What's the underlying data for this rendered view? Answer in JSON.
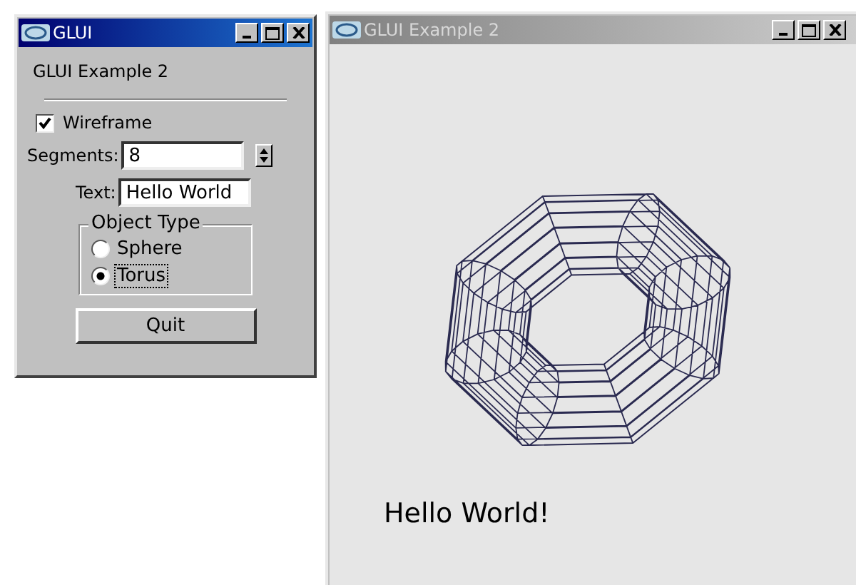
{
  "control_window": {
    "title": "GLUI",
    "active": true,
    "heading": "GLUI Example 2",
    "wireframe": {
      "label": "Wireframe",
      "checked": true
    },
    "segments": {
      "label": "Segments:",
      "value": "8"
    },
    "text": {
      "label": "Text:",
      "value": "Hello World"
    },
    "object_type": {
      "title": "Object Type",
      "options": [
        {
          "label": "Sphere",
          "selected": false
        },
        {
          "label": "Torus",
          "selected": true
        }
      ]
    },
    "quit": "Quit"
  },
  "render_window": {
    "title": "GLUI Example 2",
    "active": false,
    "caption": "Hello World!"
  }
}
